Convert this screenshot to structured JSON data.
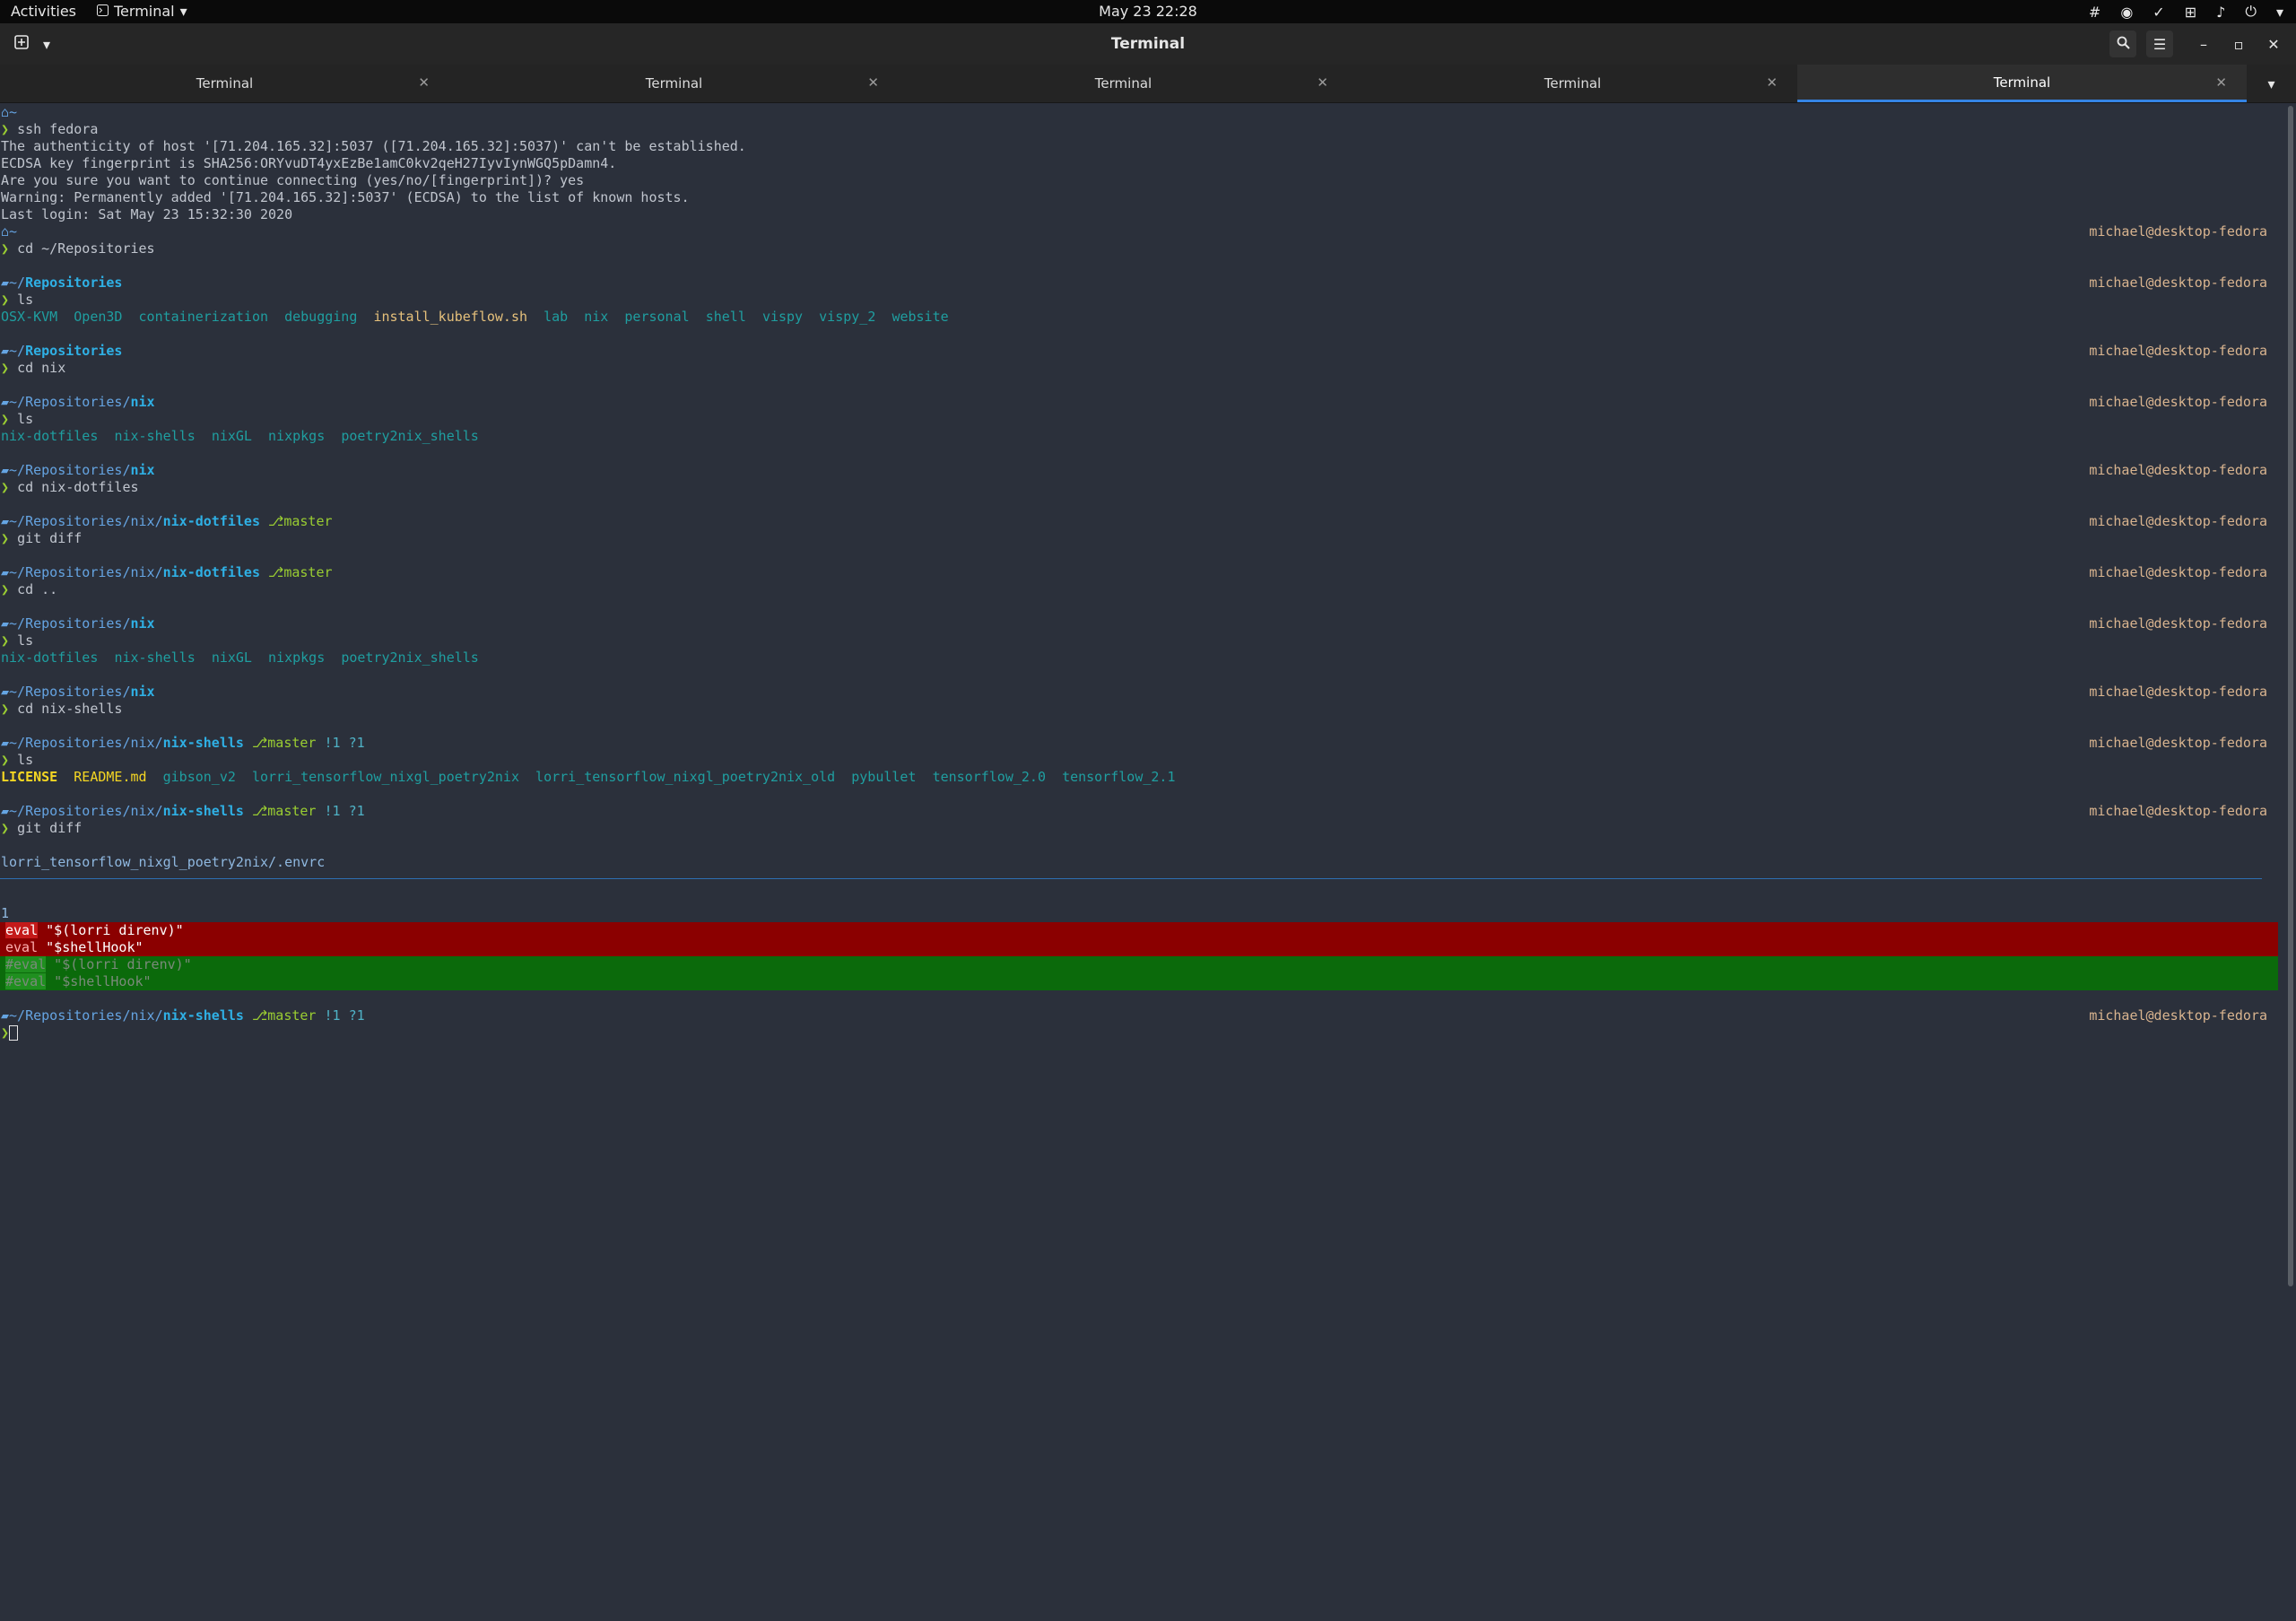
{
  "topbar": {
    "activities": "Activities",
    "app_menu": "Terminal",
    "clock": "May 23  22:28"
  },
  "window": {
    "title": "Terminal"
  },
  "tabs": [
    {
      "label": "Terminal",
      "active": false
    },
    {
      "label": "Terminal",
      "active": false
    },
    {
      "label": "Terminal",
      "active": false
    },
    {
      "label": "Terminal",
      "active": false
    },
    {
      "label": "Terminal",
      "active": true
    }
  ],
  "terminal": {
    "host": "michael@desktop-fedora",
    "home": "~",
    "prompt_char": "❯",
    "cmd_ssh": "ssh fedora",
    "ssh_out1": "The authenticity of host '[71.204.165.32]:5037 ([71.204.165.32]:5037)' can't be established.",
    "ssh_out2": "ECDSA key fingerprint is SHA256:ORYvuDT4yxEzBe1amC0kv2qeH27IyvIynWGQ5pDamn4.",
    "ssh_out3": "Are you sure you want to continue connecting (yes/no/[fingerprint])? yes",
    "ssh_out4": "Warning: Permanently added '[71.204.165.32]:5037' (ECDSA) to the list of known hosts.",
    "ssh_out5": "Last login: Sat May 23 15:32:30 2020",
    "cmd_cd_repos": "cd ~/Repositories",
    "path_repos_prefix": "~/",
    "path_repos_bold": "Repositories",
    "cmd_ls": "ls",
    "ls_repos": [
      "OSX-KVM",
      "Open3D",
      "containerization",
      "debugging",
      "install_kubeflow.sh",
      "lab",
      "nix",
      "personal",
      "shell",
      "vispy",
      "vispy_2",
      "website"
    ],
    "cmd_cd_nix": "cd nix",
    "path_nix_prefix": "~/Repositories/",
    "path_nix_bold": "nix",
    "ls_nix": [
      "nix-dotfiles",
      "nix-shells",
      "nixGL",
      "nixpkgs",
      "poetry2nix_shells"
    ],
    "cmd_cd_dotfiles": "cd nix-dotfiles",
    "path_dot_prefix": "~/Repositories/nix/",
    "path_dot_bold": "nix-dotfiles",
    "branch": "master",
    "cmd_git_diff": "git diff",
    "cmd_cd_up": "cd ..",
    "cmd_cd_shells": "cd nix-shells",
    "path_shells_prefix": "~/Repositories/nix/",
    "path_shells_bold": "nix-shells",
    "git_status": "!1 ?1",
    "ls_shells": [
      "LICENSE",
      "README.md",
      "gibson_v2",
      "lorri_tensorflow_nixgl_poetry2nix",
      "lorri_tensorflow_nixgl_poetry2nix_old",
      "pybullet",
      "tensorflow_2.0",
      "tensorflow_2.1"
    ],
    "diff_file": "lorri_tensorflow_nixgl_poetry2nix/.envrc",
    "diff_hunk": "1",
    "diff_removed": [
      {
        "kw": "eval",
        "rest": " \"$(lorri direnv)\""
      },
      {
        "kw": "eval",
        "rest": " \"$shellHook\""
      }
    ],
    "diff_added": [
      {
        "kw": "#eval",
        "rest": " \"$(lorri direnv)\""
      },
      {
        "kw": "#eval",
        "rest": " \"$shellHook\""
      }
    ]
  }
}
